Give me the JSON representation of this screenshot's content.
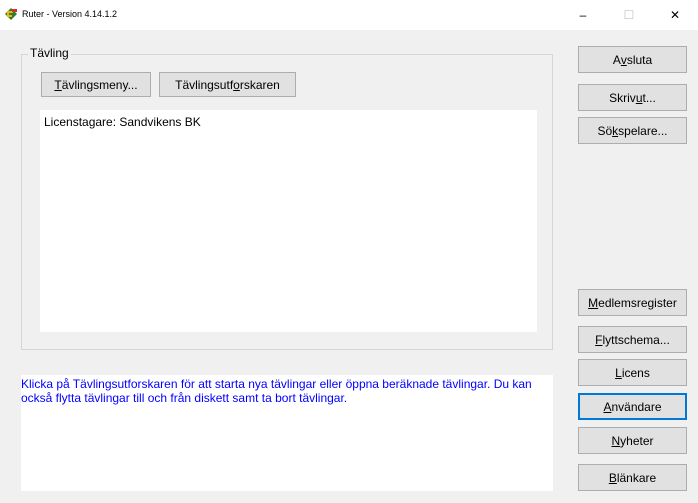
{
  "window": {
    "title": "Ruter - Version 4.14.1.2",
    "min_glyph": "–",
    "max_glyph": "☐",
    "close_glyph": "✕"
  },
  "competition": {
    "group_label": "Tävling",
    "menu_button": {
      "pre": "",
      "key": "T",
      "post": "ävlingsmeny..."
    },
    "explorer_button": {
      "pre": "Tävlingsutf",
      "key": "o",
      "post": "rskaren"
    },
    "licensee_text": "Licenstagare: Sandvikens BK"
  },
  "info_text": "Klicka på Tävlingsutforskaren för att starta nya tävlingar eller öppna beräknade tävlingar. Du kan också flytta tävlingar till och från diskett samt ta bort tävlingar.",
  "side_buttons": {
    "quit": {
      "pre": "A",
      "key": "v",
      "post": "sluta"
    },
    "print": {
      "pre": "Skriv ",
      "key": "u",
      "post": "t..."
    },
    "search_player": {
      "pre": "Sö",
      "key": "k",
      "post": " spelare..."
    },
    "member_register": {
      "pre": "",
      "key": "M",
      "post": "edlemsregister"
    },
    "move_schedule": {
      "pre": "",
      "key": "F",
      "post": "lyttschema..."
    },
    "license": {
      "pre": "",
      "key": "L",
      "post": "icens"
    },
    "user": {
      "pre": "",
      "key": "A",
      "post": "nvändare"
    },
    "news": {
      "pre": "",
      "key": "N",
      "post": "yheter"
    },
    "forms": {
      "pre": "",
      "key": "B",
      "post": "länkare"
    }
  },
  "colors": {
    "info_text": "#0000ff",
    "focus_border": "#0078d7",
    "background": "#f0f0f0"
  },
  "icons": {
    "app": "app-logo-icon"
  }
}
